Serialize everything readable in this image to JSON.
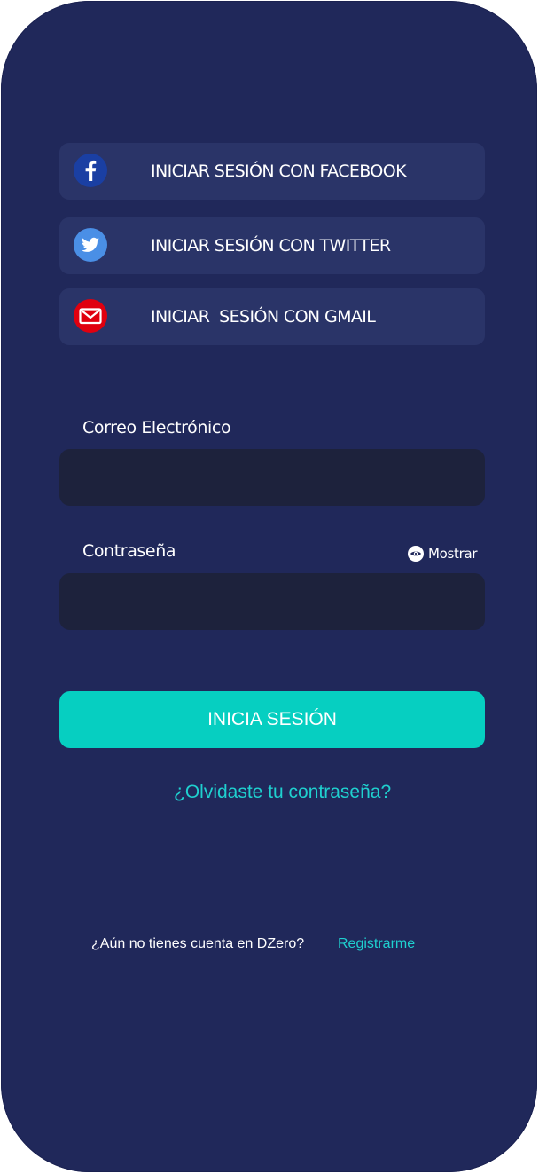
{
  "social": {
    "facebook_label": "INICIAR SESIÓN CON FACEBOOK",
    "twitter_label": "INICIAR SESIÓN CON TWITTER",
    "gmail_label": "INICIAR  SESIÓN CON GMAIL"
  },
  "form": {
    "email_label": "Correo Electrónico",
    "email_value": "",
    "password_label": "Contraseña",
    "password_value": "",
    "show_label": "Mostrar",
    "submit_label": "INICIA SESIÓN",
    "forgot_label": "¿Olvidaste tu contraseña?"
  },
  "footer": {
    "no_account_text": "¿Aún no tienes cuenta en DZero?",
    "register_label": "Registrarme"
  },
  "colors": {
    "background": "#20285a",
    "social_button": "#2a3468",
    "input": "#1d223c",
    "accent": "#06cfc1",
    "link": "#1fd0cf",
    "facebook": "#1a3fa3",
    "twitter": "#4a8fe6",
    "gmail": "#e0000f"
  },
  "icons": {
    "facebook": "facebook-icon",
    "twitter": "twitter-icon",
    "gmail": "mail-icon",
    "show": "eye-icon"
  }
}
